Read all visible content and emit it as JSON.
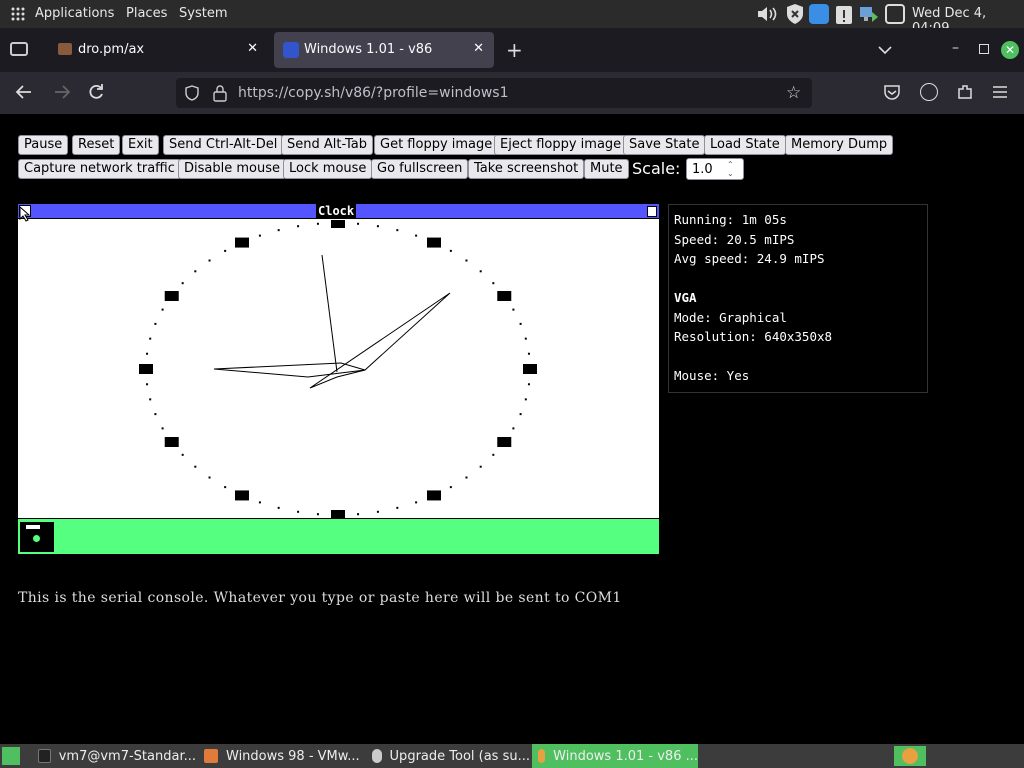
{
  "topbar": {
    "applications": "Applications",
    "places": "Places",
    "system": "System",
    "clock": "Wed Dec 4, 04:09"
  },
  "tabs": [
    {
      "label": "dro.pm/ax"
    },
    {
      "label": "Windows 1.01 - v86"
    }
  ],
  "nav": {
    "url": "https://copy.sh/v86/?profile=windows1"
  },
  "buttons": {
    "row1": [
      "Pause",
      "Reset",
      "Exit",
      "Send Ctrl-Alt-Del",
      "Send Alt-Tab",
      "Get floppy image",
      "Eject floppy image",
      "Save State",
      "Load State",
      "Memory Dump"
    ],
    "row2": [
      "Capture network traffic",
      "Disable mouse",
      "Lock mouse",
      "Go fullscreen",
      "Take screenshot",
      "Mute"
    ]
  },
  "scale": {
    "label": "Scale:",
    "value": "1.0"
  },
  "emulator": {
    "window_title": "Clock"
  },
  "info": {
    "running": "Running: 1m 05s",
    "speed": "Speed: 20.5 mIPS",
    "avg": "Avg speed: 24.9 mIPS",
    "vga": "VGA",
    "mode": "Mode: Graphical",
    "resolution": "Resolution: 640x350x8",
    "mouse": "Mouse: Yes"
  },
  "serial": {
    "text": "This is the serial console. Whatever you type or paste here will be sent to COM1"
  },
  "taskbar": [
    {
      "label": "vm7@vm7-Standar...",
      "icon": "terminal-icon"
    },
    {
      "label": "Windows 98 - VMw...",
      "icon": "vmware-icon"
    },
    {
      "label": "Upgrade Tool (as su...",
      "icon": "shield-icon"
    },
    {
      "label": "Windows 1.01 - v86 ...",
      "icon": "firefox-icon"
    }
  ],
  "colors": {
    "accent": "#5555ff",
    "iconbar": "#55ff7f",
    "taskbar_active": "#4fbf60"
  },
  "clock_face": {
    "hour_markers": 12,
    "dot_ticks": 60
  }
}
